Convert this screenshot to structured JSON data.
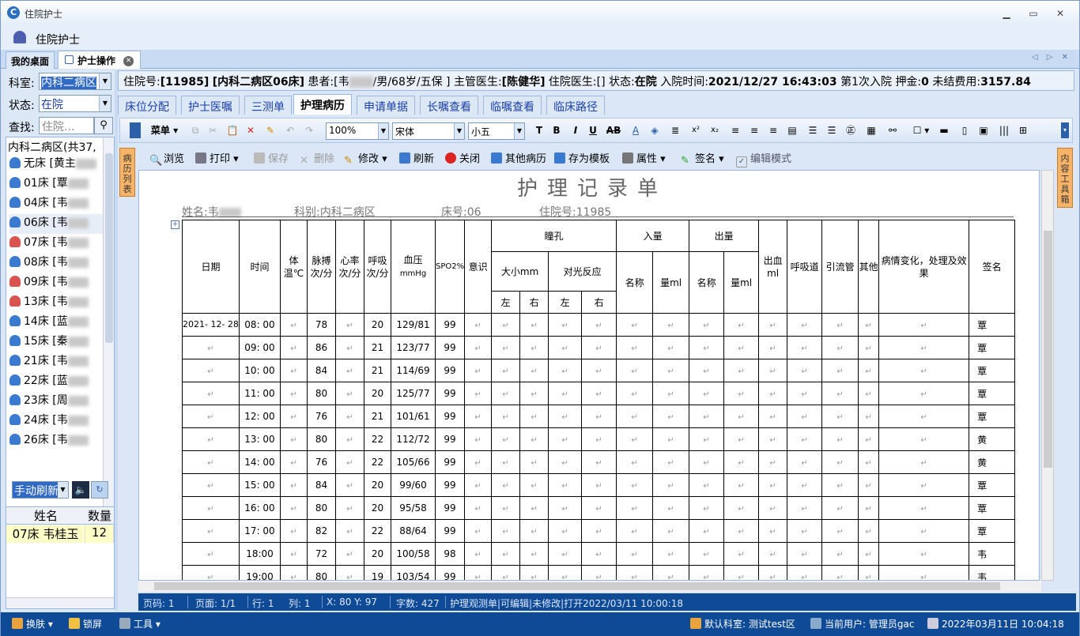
{
  "window": {
    "title": "住院护士",
    "app_title": "住院护士"
  },
  "tabs": {
    "desk": "我的桌面",
    "nurse_op": "护士操作"
  },
  "filters": {
    "dept_label": "科室:",
    "dept_value": "内科二病区",
    "status_label": "状态:",
    "status_value": "在院",
    "search_label": "查找:",
    "search_placeholder": "住院..."
  },
  "bedlist": {
    "header": "内科二病区(共37,",
    "items": [
      {
        "label": "无床 [黄主",
        "gender": "m"
      },
      {
        "label": "01床 [覃",
        "gender": "m"
      },
      {
        "label": "04床 [韦",
        "gender": "m"
      },
      {
        "label": "06床 [韦",
        "gender": "m"
      },
      {
        "label": "07床 [韦",
        "gender": "f"
      },
      {
        "label": "08床 [韦",
        "gender": "m"
      },
      {
        "label": "09床 [韦",
        "gender": "f"
      },
      {
        "label": "13床 [韦",
        "gender": "f"
      },
      {
        "label": "14床 [蓝",
        "gender": "m"
      },
      {
        "label": "15床 [秦",
        "gender": "m"
      },
      {
        "label": "21床 [韦",
        "gender": "m"
      },
      {
        "label": "22床 [蓝",
        "gender": "m"
      },
      {
        "label": "23床 [周",
        "gender": "m"
      },
      {
        "label": "24床 [韦",
        "gender": "m"
      },
      {
        "label": "26床 [韦",
        "gender": "m"
      }
    ]
  },
  "refresh": {
    "value": "手动刷新"
  },
  "queue": {
    "col_name": "姓名",
    "col_count": "数量",
    "row_name": "07床 韦桂玉",
    "row_count": "12"
  },
  "patient_info": {
    "inpatient_no_label": "住院号:",
    "inpatient_no": "[11985]",
    "ward": "[内科二病区06床]",
    "patient_label": "患者:",
    "patient_prefix": "[韦",
    "patient_suffix": "/男/68岁/五保 ]",
    "chief_label": "主管医生:",
    "chief": "[陈健华]",
    "resident_label": "住院医生:",
    "resident": "[]",
    "status_label": "状态:",
    "status": "在院",
    "admit_label": "入院时间:",
    "admit": "2021/12/27 16:43:03",
    "times": "第1次入院",
    "deposit_label": "押金:",
    "deposit": "0",
    "fee_label": "未结费用:",
    "fee": "3157.84"
  },
  "main_tabs": [
    "床位分配",
    "护士医嘱",
    "三测单",
    "护理病历",
    "申请单据",
    "长嘱查看",
    "临嘱查看",
    "临床路径"
  ],
  "editor": {
    "menu_label": "菜单",
    "zoom": "100%",
    "font": "宋体",
    "size": "小五"
  },
  "actions": {
    "browse": "浏览",
    "print": "打印",
    "save": "保存",
    "delete": "删除",
    "edit": "修改",
    "refresh": "刷新",
    "close": "关闭",
    "other": "其他病历",
    "save_tpl": "存为模板",
    "props": "属性",
    "sign": "签名",
    "edit_mode": "编辑模式"
  },
  "side_tabs": {
    "left": "病历列表",
    "right": "内容工具箱"
  },
  "document": {
    "title": "护理记录单",
    "name_label": "姓名:韦",
    "dept": "科别:内科二病区",
    "bed": "床号:06",
    "inpatient_no": "住院号:11985",
    "headers": {
      "date": "日期",
      "time": "时间",
      "temp": "体温℃",
      "pulse": "脉搏次/分",
      "heart": "心率次/分",
      "resp": "呼吸次/分",
      "bp": "血压",
      "bp_unit": "mmHg",
      "spo2": "SPO2%",
      "conscious": "意识",
      "pupil": "瞳孔",
      "size": "大小mm",
      "light": "对光反应",
      "left": "左",
      "right": "右",
      "intake": "入量",
      "output": "出量",
      "name": "名称",
      "amount": "量ml",
      "bleed": "出血ml",
      "airway": "呼吸道",
      "drain": "引流管",
      "other": "其他",
      "change": "病情变化，处理及效果",
      "sign": "签名"
    },
    "rows": [
      {
        "date": "2021- 12- 28",
        "time": "08: 00",
        "pulse": "78",
        "resp": "20",
        "bp": "129/81",
        "spo2": "99",
        "sign": "覃"
      },
      {
        "date": "",
        "time": "09: 00",
        "pulse": "86",
        "resp": "21",
        "bp": "123/77",
        "spo2": "99",
        "sign": "覃"
      },
      {
        "date": "",
        "time": "10: 00",
        "pulse": "84",
        "resp": "21",
        "bp": "114/69",
        "spo2": "99",
        "sign": "覃"
      },
      {
        "date": "",
        "time": "11: 00",
        "pulse": "80",
        "resp": "20",
        "bp": "125/77",
        "spo2": "99",
        "sign": "覃"
      },
      {
        "date": "",
        "time": "12: 00",
        "pulse": "76",
        "resp": "21",
        "bp": "101/61",
        "spo2": "99",
        "sign": "覃"
      },
      {
        "date": "",
        "time": "13: 00",
        "pulse": "80",
        "resp": "22",
        "bp": "112/72",
        "spo2": "99",
        "sign": "黄"
      },
      {
        "date": "",
        "time": "14: 00",
        "pulse": "76",
        "resp": "22",
        "bp": "105/66",
        "spo2": "99",
        "sign": "黄"
      },
      {
        "date": "",
        "time": "15: 00",
        "pulse": "84",
        "resp": "20",
        "bp": "99/60",
        "spo2": "99",
        "sign": "覃"
      },
      {
        "date": "",
        "time": "16: 00",
        "pulse": "80",
        "resp": "20",
        "bp": "95/58",
        "spo2": "99",
        "sign": "覃"
      },
      {
        "date": "",
        "time": "17: 00",
        "pulse": "82",
        "resp": "22",
        "bp": "88/64",
        "spo2": "99",
        "sign": "覃"
      },
      {
        "date": "",
        "time": "18:00",
        "pulse": "72",
        "resp": "20",
        "bp": "100/58",
        "spo2": "98",
        "sign": "韦"
      },
      {
        "date": "",
        "time": "19:00",
        "pulse": "80",
        "resp": "19",
        "bp": "103/54",
        "spo2": "99",
        "sign": "韦"
      }
    ]
  },
  "status": {
    "page_code": "页码: 1",
    "page": "页面: 1/1",
    "row": "行: 1",
    "col": "列: 1",
    "xy": "X: 80 Y: 97",
    "chars": "字数: 427",
    "doc_state": "护理观测单|可编辑|未修改|打开2022/03/11 10:00:18"
  },
  "bottombar": {
    "skin": "换肤",
    "lock": "锁屏",
    "tools": "工具",
    "dept": "默认科室: 测试test区",
    "user": "当前用户: 管理员gac",
    "datetime": "2022年03月11日 10:04:18"
  }
}
